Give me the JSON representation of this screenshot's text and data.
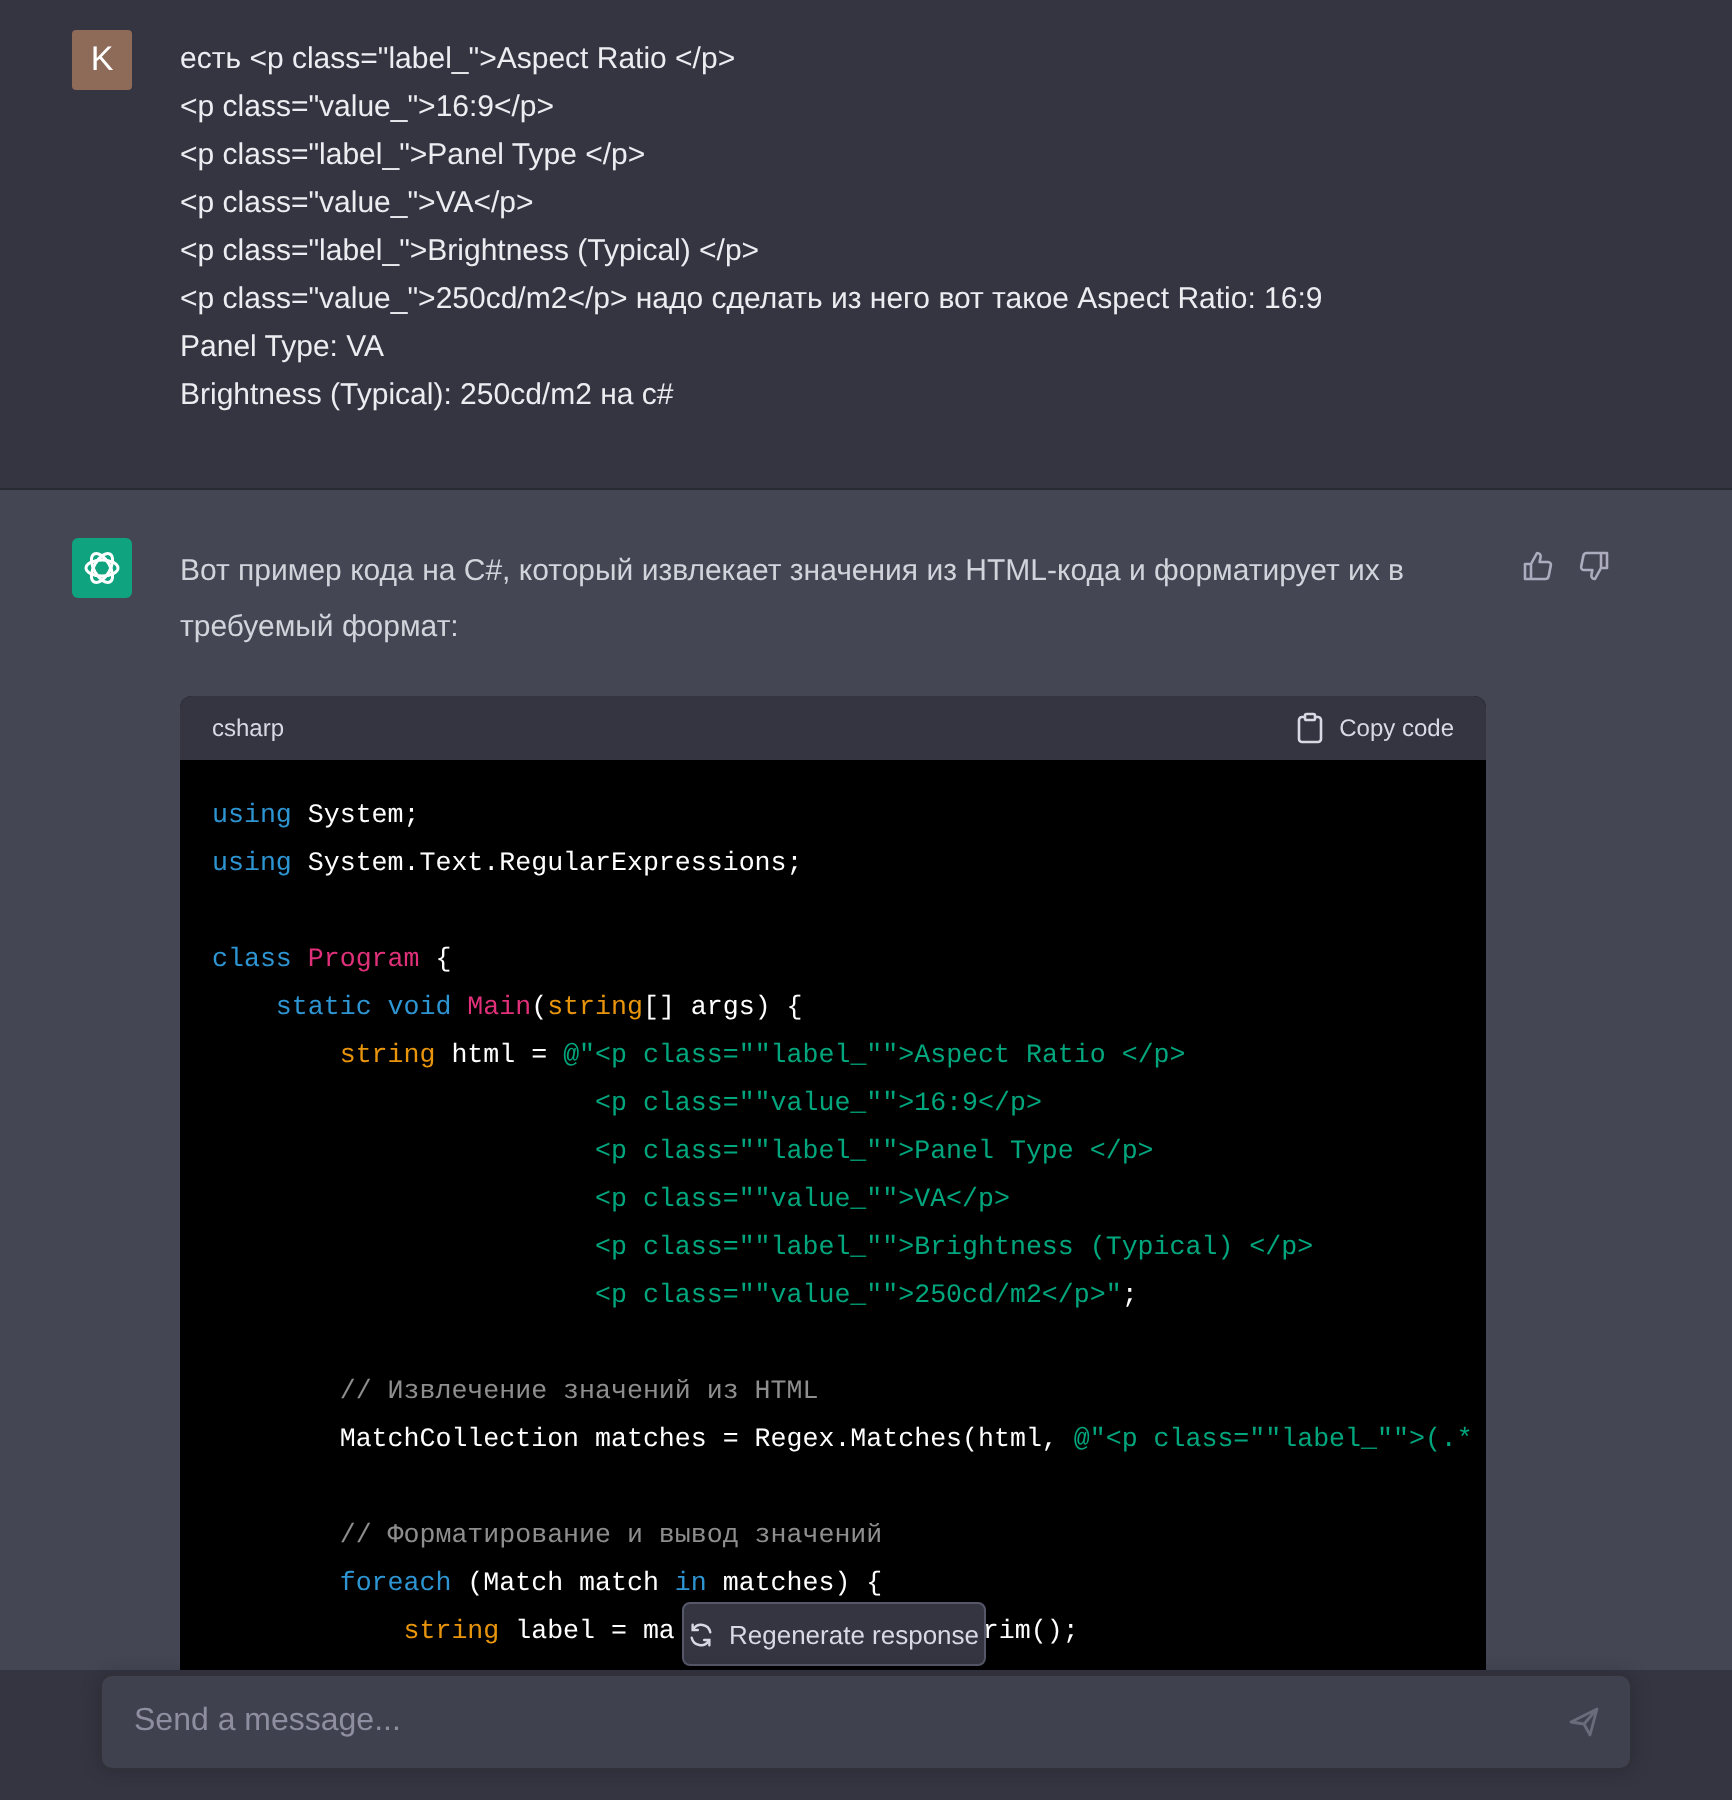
{
  "user_message": {
    "avatar_letter": "K",
    "lines": [
      "есть <p class=\"label_\">Aspect Ratio </p>",
      "<p class=\"value_\">16:9</p>",
      "<p class=\"label_\">Panel Type </p>",
      "<p class=\"value_\">VA</p>",
      "<p class=\"label_\">Brightness (Typical) </p>",
      "<p class=\"value_\">250cd/m2</p> надо сделать из него вот такое Aspect Ratio: 16:9",
      "Panel Type: VA",
      "Brightness (Typical): 250cd/m2 на c#"
    ]
  },
  "assistant_message": {
    "text": "Вот пример кода на C#, который извлекает значения из HTML-кода и форматирует их в требуемый формат:",
    "code": {
      "language": "csharp",
      "copy_label": "Copy code",
      "lines": [
        {
          "kind": "code",
          "tokens": [
            {
              "t": "using",
              "kind": "kw"
            },
            {
              "t": " System;",
              "kind": "plain"
            }
          ]
        },
        {
          "kind": "code",
          "tokens": [
            {
              "t": "using",
              "kind": "kw"
            },
            {
              "t": " System.Text.RegularExpressions;",
              "kind": "plain"
            }
          ]
        },
        {
          "kind": "blank"
        },
        {
          "kind": "code",
          "tokens": [
            {
              "t": "class ",
              "kind": "kw"
            },
            {
              "t": "Program",
              "kind": "name"
            },
            {
              "t": " {",
              "kind": "plain"
            }
          ]
        },
        {
          "kind": "code",
          "tokens": [
            {
              "t": "    static void ",
              "kind": "kw"
            },
            {
              "t": "Main",
              "kind": "name"
            },
            {
              "t": "(",
              "kind": "plain"
            },
            {
              "t": "string",
              "kind": "type"
            },
            {
              "t": "[] args) {",
              "kind": "plain"
            }
          ]
        },
        {
          "kind": "code",
          "tokens": [
            {
              "t": "        string",
              "kind": "type"
            },
            {
              "t": " html = ",
              "kind": "plain"
            },
            {
              "t": "@\"<p class=\"\"label_\"\">Aspect Ratio </p>",
              "kind": "str"
            }
          ]
        },
        {
          "kind": "code",
          "tokens": [
            {
              "t": "                        <p class=\"\"value_\"\">16:9</p>",
              "kind": "str"
            }
          ]
        },
        {
          "kind": "code",
          "tokens": [
            {
              "t": "                        <p class=\"\"label_\"\">Panel Type </p>",
              "kind": "str"
            }
          ]
        },
        {
          "kind": "code",
          "tokens": [
            {
              "t": "                        <p class=\"\"value_\"\">VA</p>",
              "kind": "str"
            }
          ]
        },
        {
          "kind": "code",
          "tokens": [
            {
              "t": "                        <p class=\"\"label_\"\">Brightness (Typical) </p>",
              "kind": "str"
            }
          ]
        },
        {
          "kind": "code",
          "tokens": [
            {
              "t": "                        <p class=\"\"value_\"\">250cd/m2</p>\"",
              "kind": "str"
            },
            {
              "t": ";",
              "kind": "plain"
            }
          ]
        },
        {
          "kind": "blank"
        },
        {
          "kind": "code",
          "tokens": [
            {
              "t": "        // Извлечение значений из HTML",
              "kind": "comment"
            }
          ]
        },
        {
          "kind": "code",
          "tokens": [
            {
              "t": "        MatchCollection matches = Regex.Matches(html, ",
              "kind": "plain"
            },
            {
              "t": "@\"<p class=\"\"label_\"\">(.*",
              "kind": "str"
            }
          ]
        },
        {
          "kind": "blank"
        },
        {
          "kind": "code",
          "tokens": [
            {
              "t": "        // Форматирование и вывод значений",
              "kind": "comment"
            }
          ]
        },
        {
          "kind": "code",
          "tokens": [
            {
              "t": "        foreach",
              "kind": "kw"
            },
            {
              "t": " (Match match ",
              "kind": "plain"
            },
            {
              "t": "in",
              "kind": "kw"
            },
            {
              "t": " matches) {",
              "kind": "plain"
            }
          ]
        },
        {
          "kind": "code",
          "tokens": [
            {
              "t": "            string",
              "kind": "type"
            },
            {
              "t": " label = ma",
              "kind": "plain"
            },
            {
              "t": "rim();",
              "kind": "plain",
              "covered_before": true
            }
          ]
        }
      ]
    }
  },
  "regenerate_button": {
    "label": "Regenerate response"
  },
  "composer": {
    "placeholder": "Send a message..."
  }
}
